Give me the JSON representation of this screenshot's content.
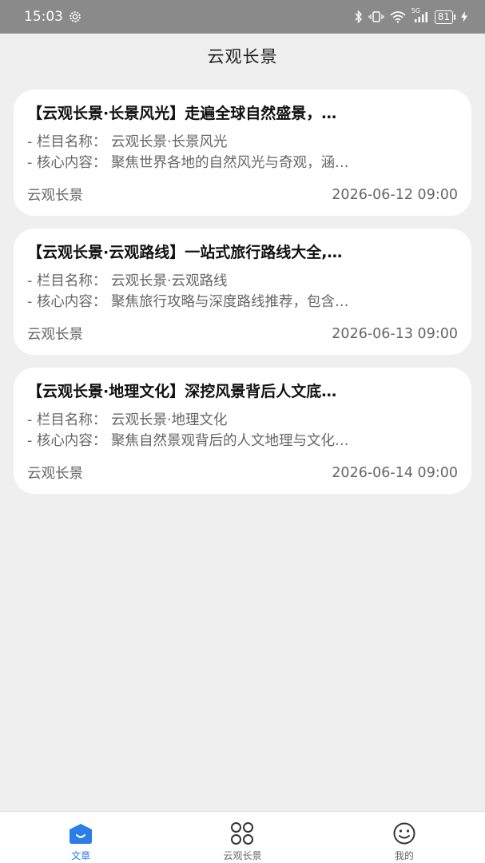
{
  "status_bar": {
    "time": "15:03",
    "network": "5G",
    "battery": "81"
  },
  "header": {
    "title": "云观长景"
  },
  "articles": [
    {
      "title": "【云观长景·长景风光】走遍全球自然盛景，…",
      "column_line": "- 栏目名称：  云观长景·长景风光",
      "content_line": "- 核心内容：  聚焦世界各地的自然风光与奇观，涵…",
      "source": "云观长景",
      "date": "2026-06-12 09:00"
    },
    {
      "title": "【云观长景·云观路线】一站式旅行路线大全,…",
      "column_line": "- 栏目名称：  云观长景·云观路线",
      "content_line": "- 核心内容：  聚焦旅行攻略与深度路线推荐，包含…",
      "source": "云观长景",
      "date": "2026-06-13 09:00"
    },
    {
      "title": "【云观长景·地理文化】深挖风景背后人文底…",
      "column_line": "- 栏目名称：  云观长景·地理文化",
      "content_line": "- 核心内容：  聚焦自然景观背后的人文地理与文化…",
      "source": "云观长景",
      "date": "2026-06-14 09:00"
    }
  ],
  "tabbar": {
    "tabs": [
      {
        "label": "文章",
        "icon": "home-icon",
        "active": true
      },
      {
        "label": "云观长景",
        "icon": "grid-icon",
        "active": false
      },
      {
        "label": "我的",
        "icon": "smiley-icon",
        "active": false
      }
    ]
  },
  "colors": {
    "accent": "#2a7ee6",
    "background": "#efefef",
    "status_bar": "#8a8a8a"
  }
}
